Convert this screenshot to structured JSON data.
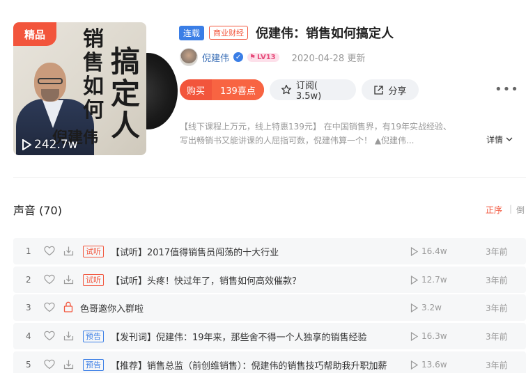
{
  "cover": {
    "badge": "精品",
    "title_line1": "销售如何",
    "title_line2": "搞定人",
    "author": "倪建伟",
    "plays": "242.7w"
  },
  "album": {
    "serial_tag": "连载",
    "category_tag": "商业财经",
    "title": "倪建伟：销售如何搞定人",
    "author_name": "倪建伟",
    "level": "LV13",
    "update_date": "2020-04-28 更新"
  },
  "actions": {
    "buy_label": "购买",
    "price": "139喜点",
    "subscribe_label": "订阅( 3.5w)",
    "share_label": "分享",
    "more_label": "•••"
  },
  "intro": {
    "text": "【线下课程上万元，线上特惠139元】 在中国销售界，有19年实战经验、写出畅销书又能讲课的人屈指可数，倪建伟算一个！ ▲倪建伟...",
    "detail_label": "详情"
  },
  "tracks_section": {
    "title": "声音 (70)",
    "sort_asc": "正序",
    "sort_sep": "|",
    "sort_desc": "倒"
  },
  "tracks": [
    {
      "num": "1",
      "tag": "试听",
      "title": "【试听】2017值得销售员闯荡的十大行业",
      "plays": "16.4w",
      "time": "3年前"
    },
    {
      "num": "2",
      "tag": "试听",
      "title": "【试听】头疼！快过年了，销售如何高效催款？",
      "plays": "12.7w",
      "time": "3年前"
    },
    {
      "num": "3",
      "tag": "",
      "title": "色哥邀你入群啦",
      "plays": "3.2w",
      "time": "3年前"
    },
    {
      "num": "4",
      "tag": "预告",
      "title": "【发刊词】倪建伟：19年来，那些舍不得一个人独享的销售经验",
      "plays": "16.3w",
      "time": "3年前"
    },
    {
      "num": "5",
      "tag": "预告",
      "title": "【推荐】销售总监（前创维销售）：倪建伟的销售技巧帮助我升职加薪",
      "plays": "13.6w",
      "time": "3年前"
    }
  ],
  "colors": {
    "accent": "#f2553c",
    "link": "#3b6fb6",
    "preview_tag": "#3a7ee6"
  }
}
